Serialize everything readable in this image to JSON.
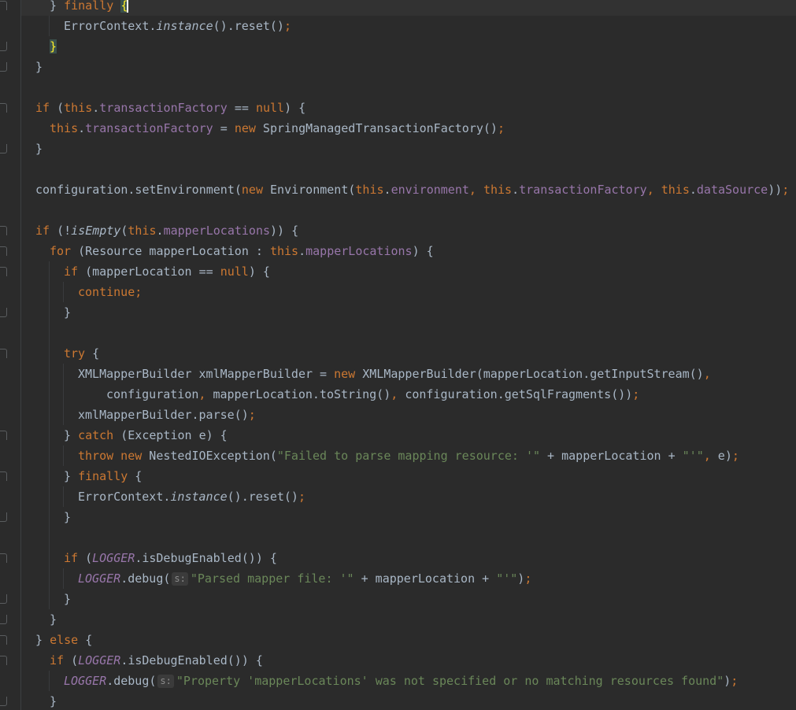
{
  "editor": {
    "lines": [
      {
        "indent": 1,
        "guides": [],
        "current": true,
        "tokens": [
          {
            "t": "} "
          },
          {
            "t": "finally",
            "c": "kw"
          },
          {
            "t": " "
          },
          {
            "t": "{",
            "c": "brace-hl"
          },
          {
            "t": "",
            "c": "caret"
          }
        ]
      },
      {
        "indent": 2,
        "guides": [
          1
        ],
        "tokens": [
          {
            "t": "ErrorContext."
          },
          {
            "t": "instance",
            "c": "st"
          },
          {
            "t": "().reset()"
          },
          {
            "t": ";",
            "c": "kw"
          }
        ]
      },
      {
        "indent": 1,
        "guides": [],
        "tokens": [
          {
            "t": "}",
            "c": "brace-hl"
          }
        ]
      },
      {
        "indent": 0,
        "guides": [],
        "tokens": [
          {
            "t": "}"
          }
        ]
      },
      {
        "indent": 0,
        "guides": [],
        "tokens": []
      },
      {
        "indent": 0,
        "guides": [],
        "tokens": [
          {
            "t": "if",
            "c": "kw"
          },
          {
            "t": " ("
          },
          {
            "t": "this",
            "c": "kw"
          },
          {
            "t": "."
          },
          {
            "t": "transactionFactory",
            "c": "fld"
          },
          {
            "t": " == "
          },
          {
            "t": "null",
            "c": "kw"
          },
          {
            "t": ") {"
          }
        ]
      },
      {
        "indent": 1,
        "guides": [],
        "tokens": [
          {
            "t": "this",
            "c": "kw"
          },
          {
            "t": "."
          },
          {
            "t": "transactionFactory",
            "c": "fld"
          },
          {
            "t": " = "
          },
          {
            "t": "new",
            "c": "kw"
          },
          {
            "t": " SpringManagedTransactionFactory()"
          },
          {
            "t": ";",
            "c": "kw"
          }
        ]
      },
      {
        "indent": 0,
        "guides": [],
        "tokens": [
          {
            "t": "}"
          }
        ]
      },
      {
        "indent": 0,
        "guides": [],
        "tokens": []
      },
      {
        "indent": 0,
        "guides": [],
        "tokens": [
          {
            "t": "configuration.setEnvironment("
          },
          {
            "t": "new",
            "c": "kw"
          },
          {
            "t": " Environment("
          },
          {
            "t": "this",
            "c": "kw"
          },
          {
            "t": "."
          },
          {
            "t": "environment",
            "c": "fld"
          },
          {
            "t": ", ",
            "c": "kw"
          },
          {
            "t": "this",
            "c": "kw"
          },
          {
            "t": "."
          },
          {
            "t": "transactionFactory",
            "c": "fld"
          },
          {
            "t": ", ",
            "c": "kw"
          },
          {
            "t": "this",
            "c": "kw"
          },
          {
            "t": "."
          },
          {
            "t": "dataSource",
            "c": "fld"
          },
          {
            "t": "))"
          },
          {
            "t": ";",
            "c": "kw"
          }
        ]
      },
      {
        "indent": 0,
        "guides": [],
        "tokens": []
      },
      {
        "indent": 0,
        "guides": [],
        "tokens": [
          {
            "t": "if",
            "c": "kw"
          },
          {
            "t": " (!"
          },
          {
            "t": "isEmpty",
            "c": "st"
          },
          {
            "t": "("
          },
          {
            "t": "this",
            "c": "kw"
          },
          {
            "t": "."
          },
          {
            "t": "mapperLocations",
            "c": "fld"
          },
          {
            "t": ")) {"
          }
        ]
      },
      {
        "indent": 1,
        "guides": [],
        "tokens": [
          {
            "t": "for",
            "c": "kw"
          },
          {
            "t": " (Resource mapperLocation : "
          },
          {
            "t": "this",
            "c": "kw"
          },
          {
            "t": "."
          },
          {
            "t": "mapperLocations",
            "c": "fld"
          },
          {
            "t": ") {"
          }
        ]
      },
      {
        "indent": 2,
        "guides": [
          1
        ],
        "tokens": [
          {
            "t": "if",
            "c": "kw"
          },
          {
            "t": " (mapperLocation == "
          },
          {
            "t": "null",
            "c": "kw"
          },
          {
            "t": ") {"
          }
        ]
      },
      {
        "indent": 3,
        "guides": [
          1,
          2
        ],
        "tokens": [
          {
            "t": "continue",
            "c": "kw"
          },
          {
            "t": ";",
            "c": "kw"
          }
        ]
      },
      {
        "indent": 2,
        "guides": [
          1
        ],
        "tokens": [
          {
            "t": "}"
          }
        ]
      },
      {
        "indent": 0,
        "guides": [
          1
        ],
        "tokens": []
      },
      {
        "indent": 2,
        "guides": [
          1
        ],
        "tokens": [
          {
            "t": "try",
            "c": "kw"
          },
          {
            "t": " {"
          }
        ]
      },
      {
        "indent": 3,
        "guides": [
          1,
          2
        ],
        "tokens": [
          {
            "t": "XMLMapperBuilder xmlMapperBuilder = "
          },
          {
            "t": "new",
            "c": "kw"
          },
          {
            "t": " XMLMapperBuilder(mapperLocation.getInputStream()"
          },
          {
            "t": ",",
            "c": "kw"
          }
        ]
      },
      {
        "indent": 5,
        "guides": [
          1,
          2
        ],
        "tokens": [
          {
            "t": "configuration"
          },
          {
            "t": ", ",
            "c": "kw"
          },
          {
            "t": "mapperLocation.toString()"
          },
          {
            "t": ", ",
            "c": "kw"
          },
          {
            "t": "configuration.getSqlFragments())"
          },
          {
            "t": ";",
            "c": "kw"
          }
        ]
      },
      {
        "indent": 3,
        "guides": [
          1,
          2
        ],
        "tokens": [
          {
            "t": "xmlMapperBuilder.parse()"
          },
          {
            "t": ";",
            "c": "kw"
          }
        ]
      },
      {
        "indent": 2,
        "guides": [
          1
        ],
        "tokens": [
          {
            "t": "} "
          },
          {
            "t": "catch",
            "c": "kw"
          },
          {
            "t": " (Exception e) {"
          }
        ]
      },
      {
        "indent": 3,
        "guides": [
          1,
          2
        ],
        "tokens": [
          {
            "t": "throw new",
            "c": "kw"
          },
          {
            "t": " NestedIOException("
          },
          {
            "t": "\"Failed to parse mapping resource: '\"",
            "c": "str"
          },
          {
            "t": " + mapperLocation + "
          },
          {
            "t": "\"'\"",
            "c": "str"
          },
          {
            "t": ", ",
            "c": "kw"
          },
          {
            "t": "e)"
          },
          {
            "t": ";",
            "c": "kw"
          }
        ]
      },
      {
        "indent": 2,
        "guides": [
          1
        ],
        "tokens": [
          {
            "t": "} "
          },
          {
            "t": "finally",
            "c": "kw"
          },
          {
            "t": " {"
          }
        ]
      },
      {
        "indent": 3,
        "guides": [
          1,
          2
        ],
        "tokens": [
          {
            "t": "ErrorContext."
          },
          {
            "t": "instance",
            "c": "st"
          },
          {
            "t": "().reset()"
          },
          {
            "t": ";",
            "c": "kw"
          }
        ]
      },
      {
        "indent": 2,
        "guides": [
          1
        ],
        "tokens": [
          {
            "t": "}"
          }
        ]
      },
      {
        "indent": 0,
        "guides": [
          1
        ],
        "tokens": []
      },
      {
        "indent": 2,
        "guides": [
          1
        ],
        "tokens": [
          {
            "t": "if",
            "c": "kw"
          },
          {
            "t": " ("
          },
          {
            "t": "LOGGER",
            "c": "cnst"
          },
          {
            "t": ".isDebugEnabled()) {"
          }
        ]
      },
      {
        "indent": 3,
        "guides": [
          1,
          2
        ],
        "tokens": [
          {
            "t": "LOGGER",
            "c": "cnst"
          },
          {
            "t": ".debug("
          },
          {
            "t": "s:",
            "c": "hint"
          },
          {
            "t": "\"Parsed mapper file: '\"",
            "c": "str"
          },
          {
            "t": " + mapperLocation + "
          },
          {
            "t": "\"'\"",
            "c": "str"
          },
          {
            "t": ")"
          },
          {
            "t": ";",
            "c": "kw"
          }
        ]
      },
      {
        "indent": 2,
        "guides": [
          1
        ],
        "tokens": [
          {
            "t": "}"
          }
        ]
      },
      {
        "indent": 1,
        "guides": [],
        "tokens": [
          {
            "t": "}"
          }
        ]
      },
      {
        "indent": 0,
        "guides": [],
        "tokens": [
          {
            "t": "} "
          },
          {
            "t": "else",
            "c": "kw"
          },
          {
            "t": " {"
          }
        ]
      },
      {
        "indent": 1,
        "guides": [],
        "tokens": [
          {
            "t": "if",
            "c": "kw"
          },
          {
            "t": " ("
          },
          {
            "t": "LOGGER",
            "c": "cnst"
          },
          {
            "t": ".isDebugEnabled()) {"
          }
        ]
      },
      {
        "indent": 2,
        "guides": [
          1
        ],
        "tokens": [
          {
            "t": "LOGGER",
            "c": "cnst"
          },
          {
            "t": ".debug("
          },
          {
            "t": "s:",
            "c": "hint"
          },
          {
            "t": "\"Property 'mapperLocations' was not specified or no matching resources found\"",
            "c": "str"
          },
          {
            "t": ")"
          },
          {
            "t": ";",
            "c": "kw"
          }
        ]
      },
      {
        "indent": 1,
        "guides": [],
        "tokens": [
          {
            "t": "}"
          }
        ]
      }
    ]
  }
}
